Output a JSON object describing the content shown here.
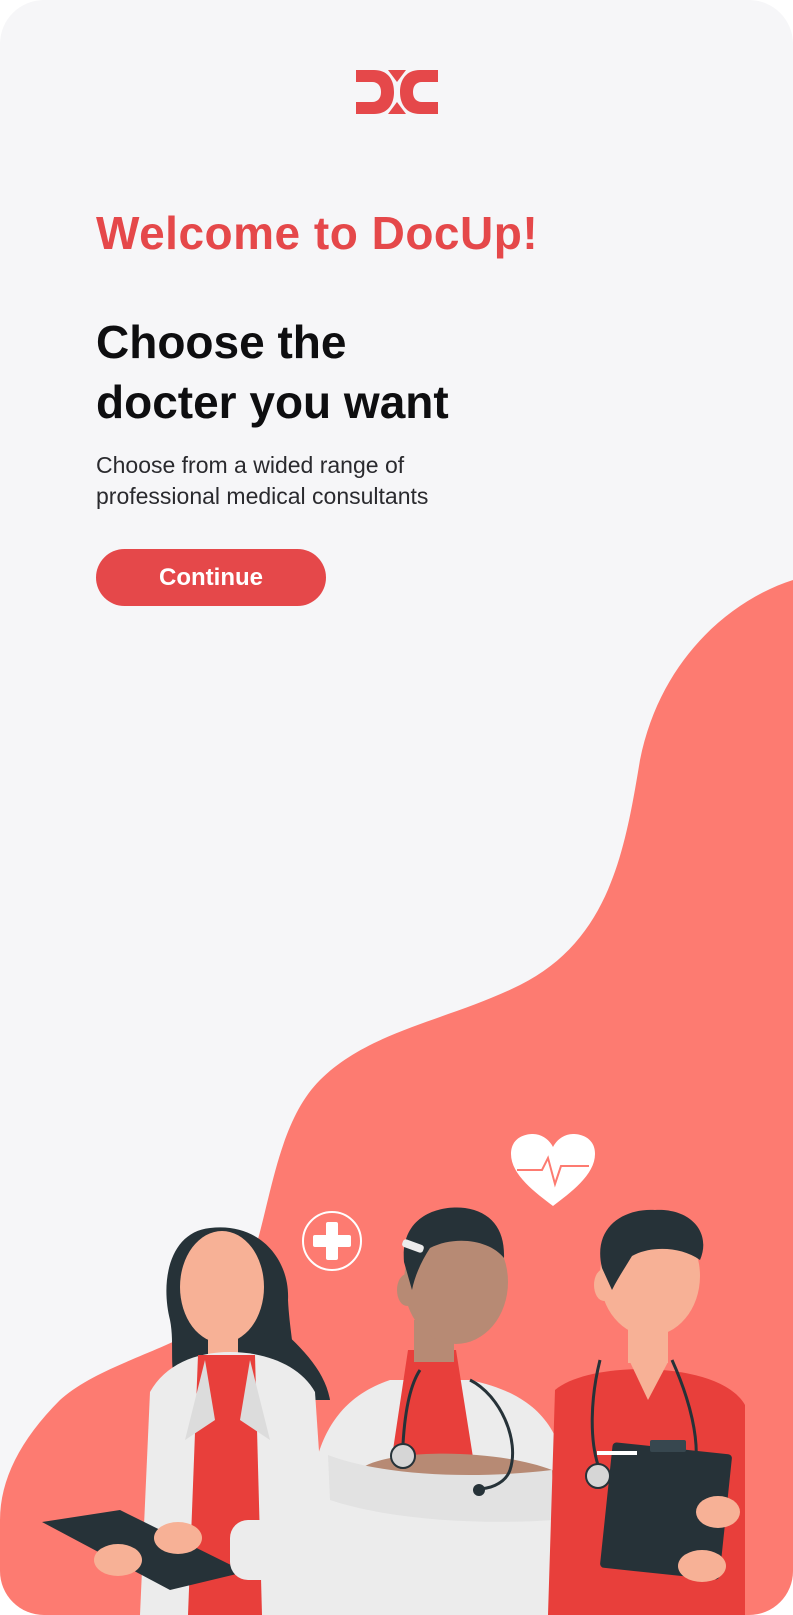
{
  "app": {
    "name": "DocUp",
    "accent_color": "#e5484a",
    "blob_color": "#fd7b71",
    "background_color": "#f6f6f8"
  },
  "logo": {
    "icon": "docup-logo-icon"
  },
  "onboarding": {
    "welcome_title": "Welcome to DocUp!",
    "headline_line1": "Choose the",
    "headline_line2": "docter you want",
    "subtitle_line1": "Choose from a wided range of",
    "subtitle_line2": "professional medical consultants",
    "continue_label": "Continue"
  },
  "illustration": {
    "icons": [
      "plus-cross-icon",
      "heart-pulse-icon"
    ],
    "figures": [
      "female-doctor-figure",
      "male-doctor-figure",
      "nurse-figure"
    ]
  }
}
